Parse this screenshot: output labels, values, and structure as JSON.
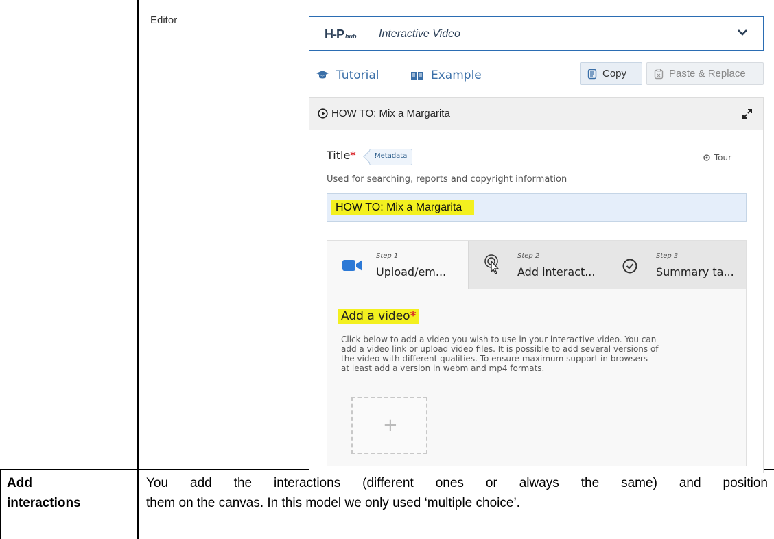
{
  "editor_label": "Editor",
  "hub": {
    "logo": "H-P",
    "logo_sub": "hub",
    "content_type": "Interactive Video"
  },
  "links": {
    "tutorial": "Tutorial",
    "example": "Example"
  },
  "buttons": {
    "copy": "Copy",
    "paste_replace": "Paste & Replace"
  },
  "panel": {
    "title": "HOW TO: Mix a Margarita"
  },
  "form": {
    "title_label": "Title",
    "required_mark": "*",
    "metadata_badge": "Metadata",
    "tour": "Tour",
    "title_description": "Used for searching, reports and copyright information",
    "title_value": "HOW TO: Mix a Margarita"
  },
  "steps": [
    {
      "num": "Step 1",
      "name": "Upload/em..."
    },
    {
      "num": "Step 2",
      "name": "Add interact..."
    },
    {
      "num": "Step 3",
      "name": "Summary ta..."
    }
  ],
  "video": {
    "heading": "Add a video",
    "description_lines": [
      "Click below to add a video you wish to use in your interactive video. You can",
      "add a video link or upload video files. It is possible to add several versions of",
      "the video with different qualities. To ensure maximum support in browsers",
      "at least add a version in webm and mp4 formats."
    ],
    "add_symbol": "+"
  },
  "table_row": {
    "label_line1": "Add",
    "label_line2": "interactions",
    "text_line1": "You add the interactions (different ones or always the same) and position",
    "text_line2": "them on the canvas. In this model we only used ‘multiple choice’."
  },
  "colors": {
    "accent_blue": "#3a6fa8",
    "highlight": "#f3f01f",
    "required_red": "#d9262b"
  }
}
